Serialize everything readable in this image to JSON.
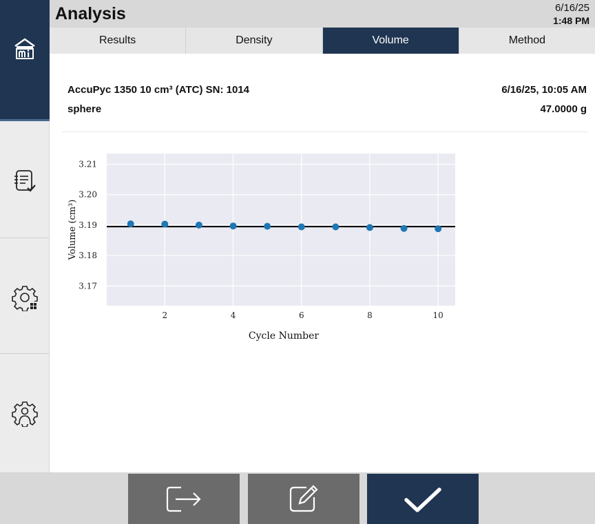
{
  "header": {
    "title": "Analysis",
    "date": "6/16/25",
    "time": "1:48 PM"
  },
  "sidebar": {
    "items": [
      {
        "icon": "home-mi-icon"
      },
      {
        "icon": "report-checklist-icon"
      },
      {
        "icon": "gear-grid-icon"
      },
      {
        "icon": "gear-user-icon"
      }
    ]
  },
  "tabs": [
    {
      "label": "Results",
      "active": false
    },
    {
      "label": "Density",
      "active": false
    },
    {
      "label": "Volume",
      "active": true
    },
    {
      "label": "Method",
      "active": false
    }
  ],
  "info": {
    "instrument": "AccuPyc 1350 10 cm³ (ATC) SN: 1014",
    "sample": "sphere",
    "datetime": "6/16/25, 10:05 AM",
    "mass": "47.0000 g"
  },
  "chart_data": {
    "type": "scatter",
    "xlabel": "Cycle Number",
    "ylabel": "Volume (cm³)",
    "x": [
      1,
      2,
      3,
      4,
      5,
      6,
      7,
      8,
      9,
      10
    ],
    "y": [
      3.1904,
      3.1903,
      3.19,
      3.1897,
      3.1896,
      3.1894,
      3.1894,
      3.1892,
      3.1889,
      3.1888
    ],
    "mean_line": 3.1895,
    "xlim": [
      0.3,
      10.5
    ],
    "ylim": [
      3.1635,
      3.2135
    ],
    "xticks": [
      "2",
      "4",
      "6",
      "8",
      "10"
    ],
    "yticks": [
      "3.21",
      "3.20",
      "3.19",
      "3.18",
      "3.17"
    ],
    "grid": true,
    "point_color": "#1f77b4",
    "line_color": "#000000",
    "background": "#eaeaf2"
  },
  "bottom_buttons": [
    {
      "icon": "exit-arrow-icon"
    },
    {
      "icon": "edit-pencil-icon"
    },
    {
      "icon": "check-icon"
    }
  ]
}
